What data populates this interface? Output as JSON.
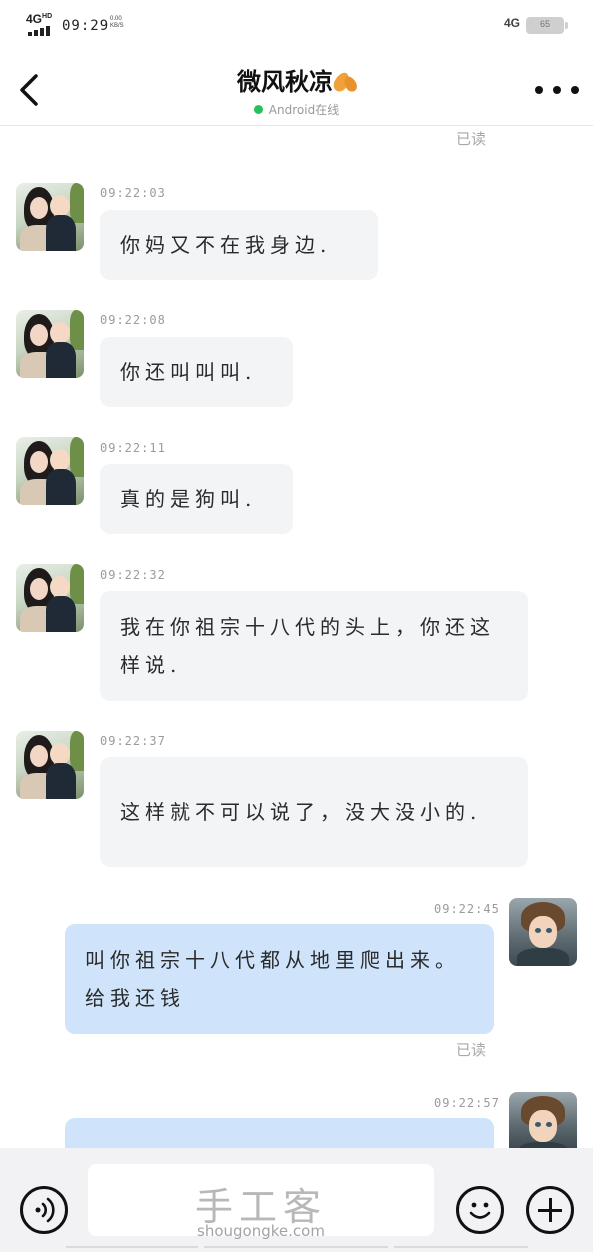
{
  "status_bar": {
    "network": "4G",
    "network_sup": "HD",
    "time": "09:29",
    "speed_value": "0.00",
    "speed_unit": "KB/S",
    "network_right": "4G",
    "battery": "65"
  },
  "header": {
    "title": "微风秋凉",
    "online_status": "Android在线",
    "online_color": "#27c15a"
  },
  "chat": {
    "top_read_label": "已读",
    "messages": [
      {
        "direction": "in",
        "time": "09:22:03",
        "text": "你妈又不在我身边."
      },
      {
        "direction": "in",
        "time": "09:22:08",
        "text": "你还叫叫叫."
      },
      {
        "direction": "in",
        "time": "09:22:11",
        "text": "真的是狗叫."
      },
      {
        "direction": "in",
        "time": "09:22:32",
        "text": "我在你祖宗十八代的头上，你还这样说."
      },
      {
        "direction": "in",
        "time": "09:22:37",
        "text": "这样就不可以说了，没大没小的."
      },
      {
        "direction": "out",
        "time": "09:22:45",
        "text": "叫你祖宗十八代都从地里爬出来。给我还钱",
        "read_label": "已读"
      },
      {
        "direction": "out",
        "time": "09:22:57",
        "text": ""
      }
    ]
  },
  "input_bar": {
    "watermark_cn": "手工客",
    "watermark_en": "shougongke.com"
  },
  "colors": {
    "incoming_bubble": "#f3f4f6",
    "outgoing_bubble": "#cfe4fb"
  }
}
